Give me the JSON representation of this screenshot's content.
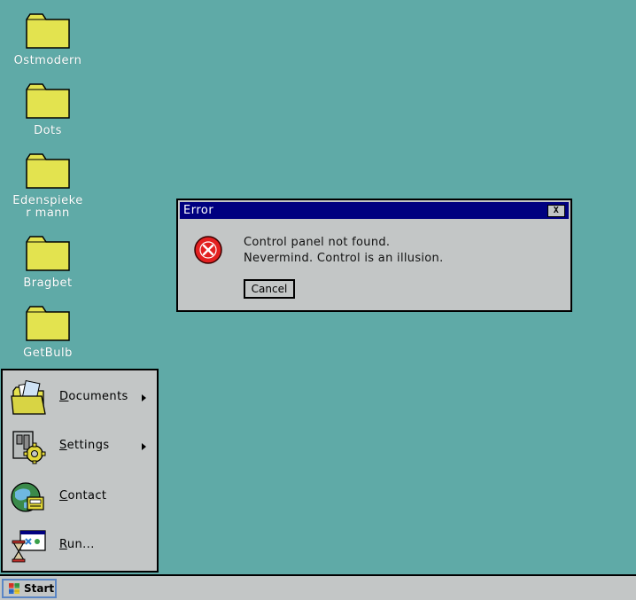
{
  "desktop": {
    "background_color": "#5faaa7",
    "icons": [
      {
        "label": "Ostmodern",
        "icon": "folder-icon"
      },
      {
        "label": "Dots",
        "icon": "folder-icon"
      },
      {
        "label": "Edenspieker mann",
        "icon": "folder-icon"
      },
      {
        "label": "Bragbet",
        "icon": "folder-icon"
      },
      {
        "label": "GetBulb",
        "icon": "folder-icon"
      }
    ]
  },
  "dialog": {
    "title": "Error",
    "close_label": "X",
    "icon": "error-icon",
    "message_line1": "Control panel not found.",
    "message_line2": "Nevermind. Control is an illusion.",
    "cancel_label": "Cancel",
    "title_color": "#000080"
  },
  "start_menu": {
    "items": [
      {
        "label_first": "D",
        "label_rest": "ocuments",
        "icon": "documents-icon",
        "has_submenu": true
      },
      {
        "label_first": "S",
        "label_rest": "ettings",
        "icon": "settings-icon",
        "has_submenu": true
      },
      {
        "label_first": "C",
        "label_rest": "ontact",
        "icon": "contact-icon",
        "has_submenu": false
      },
      {
        "label_first": "R",
        "label_rest": "un...",
        "icon": "run-icon",
        "has_submenu": false
      }
    ]
  },
  "taskbar": {
    "start_label": "Start",
    "start_icon": "windows-logo-icon"
  }
}
